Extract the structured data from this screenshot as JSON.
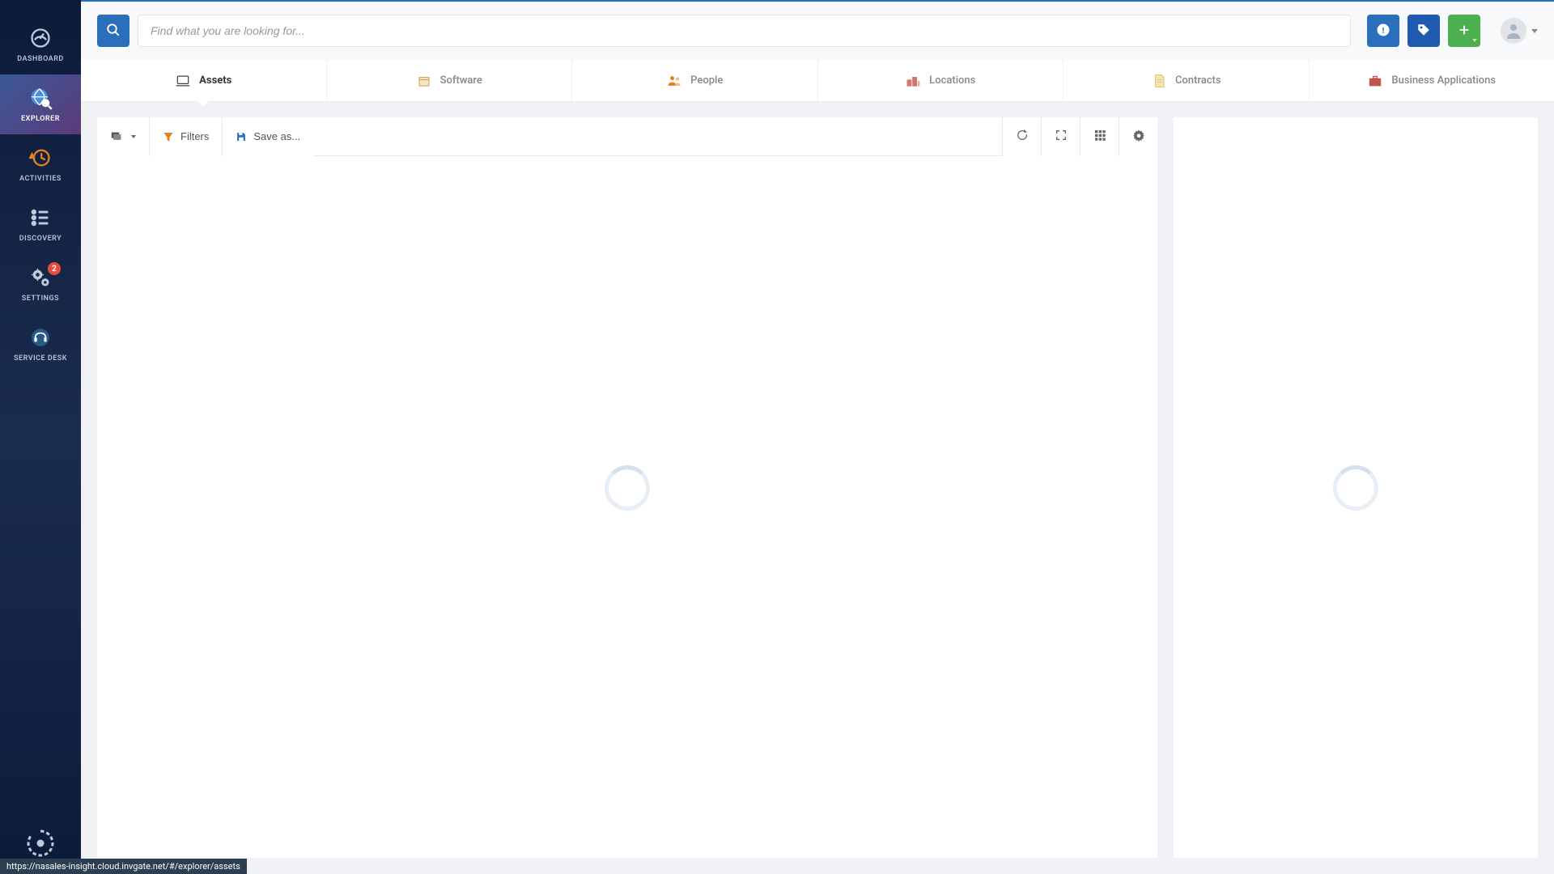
{
  "sidebar": {
    "items": [
      {
        "label": "DASHBOARD"
      },
      {
        "label": "EXPLORER"
      },
      {
        "label": "ACTIVITIES"
      },
      {
        "label": "DISCOVERY"
      },
      {
        "label": "SETTINGS",
        "badge": "2"
      },
      {
        "label": "SERVICE DESK"
      }
    ]
  },
  "header": {
    "search_placeholder": "Find what you are looking for..."
  },
  "tabs": [
    {
      "label": "Assets"
    },
    {
      "label": "Software"
    },
    {
      "label": "People"
    },
    {
      "label": "Locations"
    },
    {
      "label": "Contracts"
    },
    {
      "label": "Business Applications"
    }
  ],
  "toolbar": {
    "filters_label": "Filters",
    "saveas_label": "Save as..."
  },
  "status_url": "https://nasales-insight.cloud.invgate.net/#/explorer/assets"
}
